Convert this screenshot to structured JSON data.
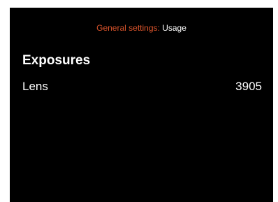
{
  "header": {
    "breadcrumb": "General settings:",
    "current": "Usage",
    "breadcrumb_color": "#d9532b"
  },
  "section": {
    "title": "Exposures"
  },
  "rows": [
    {
      "label": "Lens",
      "value": "3905"
    }
  ]
}
